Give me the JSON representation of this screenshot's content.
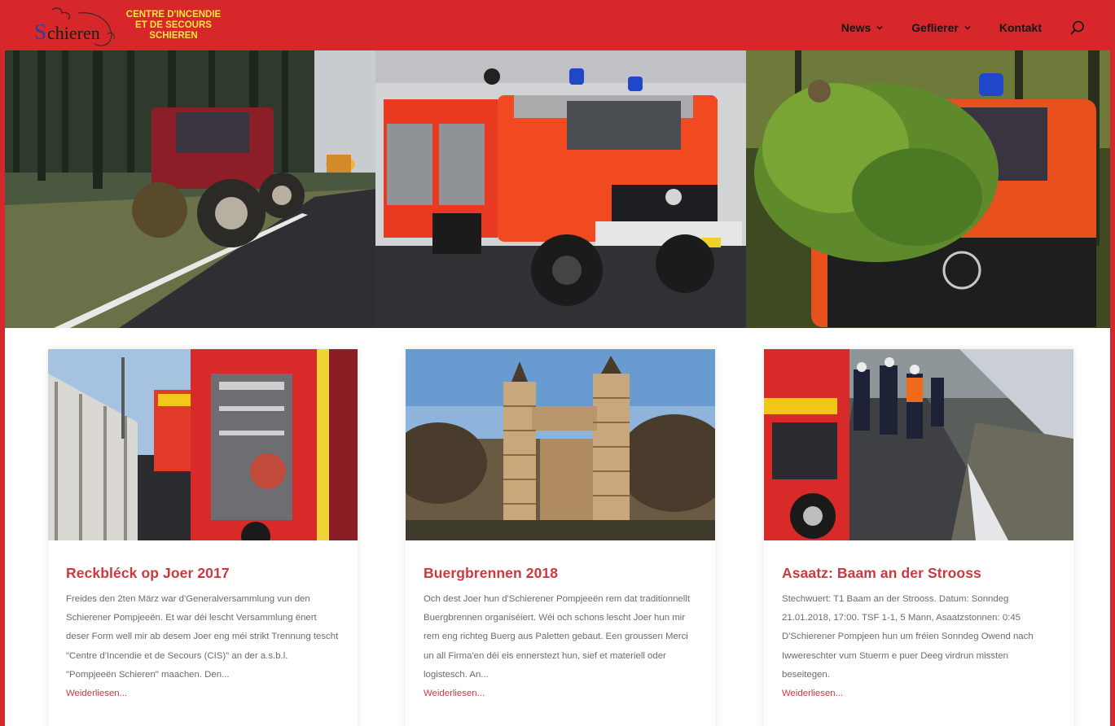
{
  "header": {
    "logo_text": "Schieren",
    "brand_line1": "CENTRE D'INCENDIE",
    "brand_line2": "ET DE SECOURS",
    "brand_line3": "SCHIEREN",
    "nav": [
      {
        "label": "News",
        "has_dropdown": true
      },
      {
        "label": "Geflierer",
        "has_dropdown": true
      },
      {
        "label": "Kontakt",
        "has_dropdown": false
      }
    ],
    "search_icon": "search-icon"
  },
  "colors": {
    "header_bg": "#d7272b",
    "brand_text": "#f6e640",
    "title_red": "#c93a40"
  },
  "posts": [
    {
      "title": "Reckbléck op Joer 2017",
      "excerpt": "Freides den 2ten März war d'Generalversammlung vun den Schierener Pompjeeën. Et war déi lescht Versammlung ënert deser Form well mir ab desem Joer eng méi strikt Trennung tescht \"Centre d'Incendie et de Secours (CIS)\" an der a.s.b.l. \"Pompjeeën Schieren\" maachen. Den...",
      "more": "Weiderliesen..."
    },
    {
      "title": "Buergbrennen 2018",
      "excerpt": "Och dest Joer hun d'Schierener Pompjeeën rem dat traditionnellt Buergbrennen organiséiert. Wéi och schons lescht Joer hun mir rem eng richteg Buerg aus Paletten gebaut. Een groussen Merci un all Firma'en déi eis ennerstezt hun, sief et materiell oder logistesch. An...",
      "more": "Weiderliesen..."
    },
    {
      "title": "Asaatz: Baam an der Strooss",
      "excerpt": "Stechwuert: T1 Baam an der Strooss. Datum: Sonndeg 21.01.2018, 17:00. TSF 1-1, 5 Mann, Asaatzstonnen: 0:45 D'Schierener Pompjeen hun um fréien Sonndeg Owend nach Iwwereschter vum Stuerm e puer Deeg virdrun missten beseitegen.",
      "more": "Weiderliesen..."
    }
  ]
}
